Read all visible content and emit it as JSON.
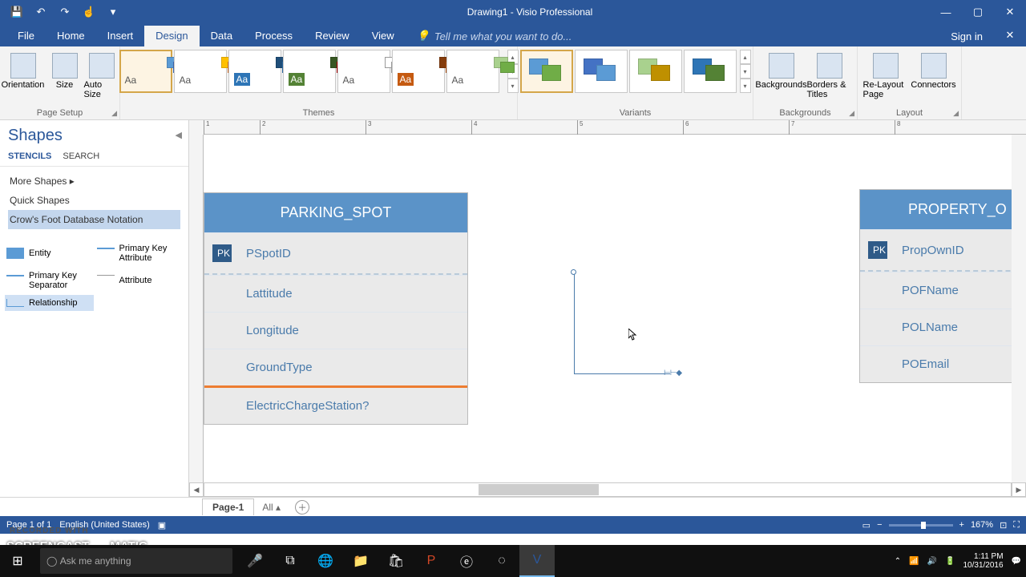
{
  "title": "Drawing1 - Visio Professional",
  "qat": {
    "save": "💾",
    "undo": "↶",
    "redo": "↷",
    "touch": "☝",
    "more": "▾"
  },
  "tabs": [
    "File",
    "Home",
    "Insert",
    "Design",
    "Data",
    "Process",
    "Review",
    "View"
  ],
  "active_tab_index": 3,
  "tellme_placeholder": "Tell me what you want to do...",
  "signin": "Sign in",
  "ribbon": {
    "page_setup": {
      "orientation": "Orientation",
      "size": "Size",
      "autosize": "Auto Size",
      "label": "Page Setup"
    },
    "themes": {
      "label": "Themes"
    },
    "variants": {
      "label": "Variants"
    },
    "backgrounds": {
      "backgrounds": "Backgrounds",
      "borders": "Borders & Titles",
      "label": "Backgrounds"
    },
    "layout": {
      "relayout": "Re-Layout Page",
      "connectors": "Connectors",
      "label": "Layout"
    }
  },
  "shapes_panel": {
    "title": "Shapes",
    "tabs": [
      "STENCILS",
      "SEARCH"
    ],
    "more": "More Shapes",
    "quick": "Quick Shapes",
    "active_stencil": "Crow's Foot Database Notation",
    "items": [
      {
        "name": "Entity"
      },
      {
        "name": "Primary Key Attribute"
      },
      {
        "name": "Primary Key Separator"
      },
      {
        "name": "Attribute"
      },
      {
        "name": "Relationship"
      }
    ]
  },
  "ruler_marks": [
    "1",
    "2",
    "3",
    "4",
    "5",
    "6",
    "7",
    "8"
  ],
  "entities": {
    "left": {
      "title": "PARKING_SPOT",
      "pk": "PK",
      "pk_field": "PSpotID",
      "attrs": [
        "Lattitude",
        "Longitude",
        "GroundType",
        "ElectricChargeStation?"
      ]
    },
    "right": {
      "title": "PROPERTY_O",
      "pk": "PK",
      "pk_field": "PropOwnID",
      "attrs": [
        "POFName",
        "POLName",
        "POEmail"
      ]
    }
  },
  "page_tabs": {
    "page1": "Page-1",
    "all": "All"
  },
  "statusbar": {
    "page": "Page 1 of 1",
    "lang": "English (United States)",
    "zoom": "167%"
  },
  "taskbar": {
    "search_placeholder": "Ask me anything",
    "time": "1:11 PM",
    "date": "10/31/2016"
  },
  "watermark_recorded": "RECORDED WITH",
  "watermark": "SCREENCAST ◉ MATIC"
}
